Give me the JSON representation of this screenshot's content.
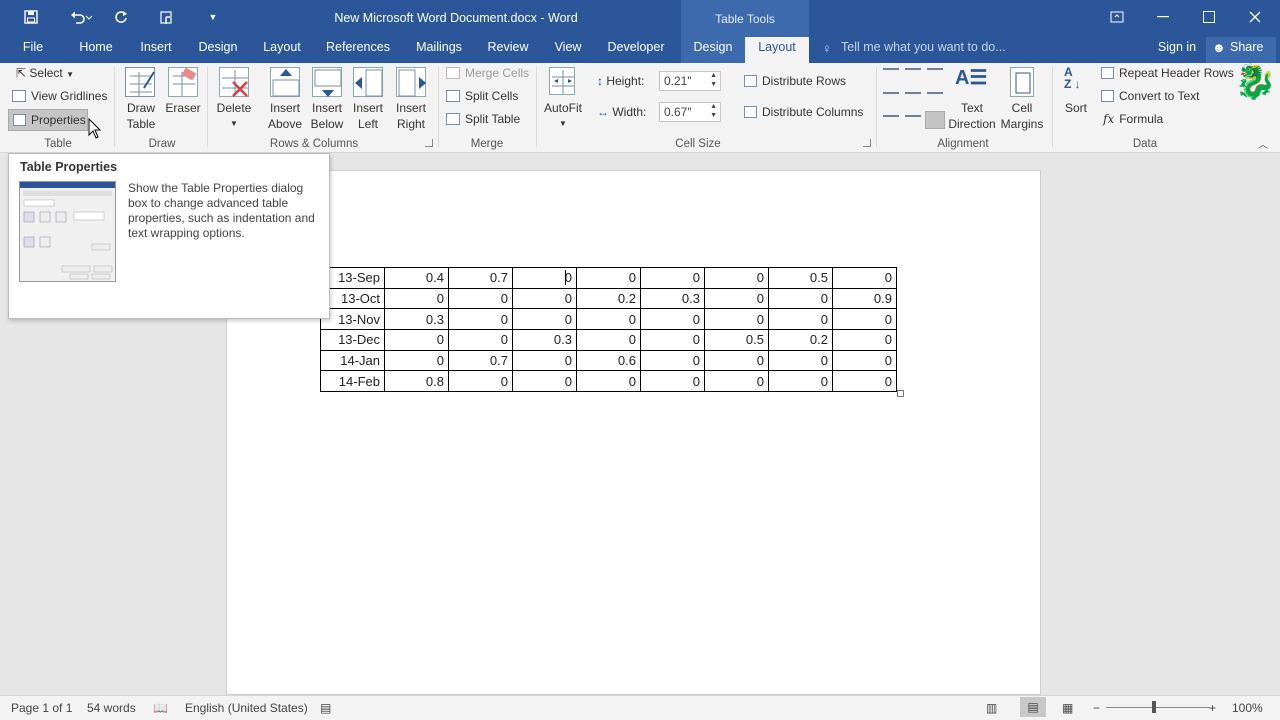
{
  "titlebar": {
    "document_title": "New Microsoft Word Document.docx - Word",
    "contextual_group": "Table Tools",
    "accent": "#2b579a"
  },
  "tabs": {
    "file": "File",
    "home": "Home",
    "insert": "Insert",
    "design": "Design",
    "layout": "Layout",
    "references": "References",
    "mailings": "Mailings",
    "review": "Review",
    "view": "View",
    "developer": "Developer",
    "tt_design": "Design",
    "tt_layout": "Layout",
    "tellme_placeholder": "Tell me what you want to do...",
    "signin": "Sign in",
    "share": "Share"
  },
  "ribbon": {
    "table": {
      "select": "Select",
      "view_gridlines": "View Gridlines",
      "properties": "Properties",
      "group": "Table"
    },
    "draw": {
      "draw_table_1": "Draw",
      "draw_table_2": "Table",
      "eraser": "Eraser",
      "group": "Draw"
    },
    "rows_cols": {
      "delete": "Delete",
      "insert_above_1": "Insert",
      "insert_above_2": "Above",
      "insert_below_1": "Insert",
      "insert_below_2": "Below",
      "insert_left_1": "Insert",
      "insert_left_2": "Left",
      "insert_right_1": "Insert",
      "insert_right_2": "Right",
      "group": "Rows & Columns"
    },
    "merge": {
      "merge_cells": "Merge Cells",
      "split_cells": "Split Cells",
      "split_table": "Split Table",
      "group": "Merge"
    },
    "cell_size": {
      "autofit": "AutoFit",
      "height_label": "Height:",
      "height_value": "0.21\"",
      "width_label": "Width:",
      "width_value": "0.67\"",
      "distribute_rows": "Distribute Rows",
      "distribute_columns": "Distribute Columns",
      "group": "Cell Size"
    },
    "alignment": {
      "text_direction_1": "Text",
      "text_direction_2": "Direction",
      "cell_margins_1": "Cell",
      "cell_margins_2": "Margins",
      "group": "Alignment"
    },
    "data": {
      "sort": "Sort",
      "repeat_header_rows": "Repeat Header Rows",
      "convert_to_text": "Convert to Text",
      "formula": "Formula",
      "formula_icon": "fx",
      "group": "Data"
    }
  },
  "tooltip": {
    "title": "Table Properties",
    "description": "Show the Table Properties dialog box to change advanced table properties, such as indentation and text wrapping options."
  },
  "table_rows": [
    [
      "13-Sep",
      "0.4",
      "0.7",
      "0",
      "0",
      "0",
      "0",
      "0.5",
      "0"
    ],
    [
      "13-Oct",
      "0",
      "0",
      "0",
      "0.2",
      "0.3",
      "0",
      "0",
      "0.9"
    ],
    [
      "13-Nov",
      "0.3",
      "0",
      "0",
      "0",
      "0",
      "0",
      "0",
      "0"
    ],
    [
      "13-Dec",
      "0",
      "0",
      "0.3",
      "0",
      "0",
      "0.5",
      "0.2",
      "0"
    ],
    [
      "14-Jan",
      "0",
      "0.7",
      "0",
      "0.6",
      "0",
      "0",
      "0",
      "0"
    ],
    [
      "14-Feb",
      "0.8",
      "0",
      "0",
      "0",
      "0",
      "0",
      "0",
      "0"
    ]
  ],
  "status": {
    "page": "Page 1 of 1",
    "words": "54 words",
    "language": "English (United States)",
    "zoom": "100%"
  }
}
